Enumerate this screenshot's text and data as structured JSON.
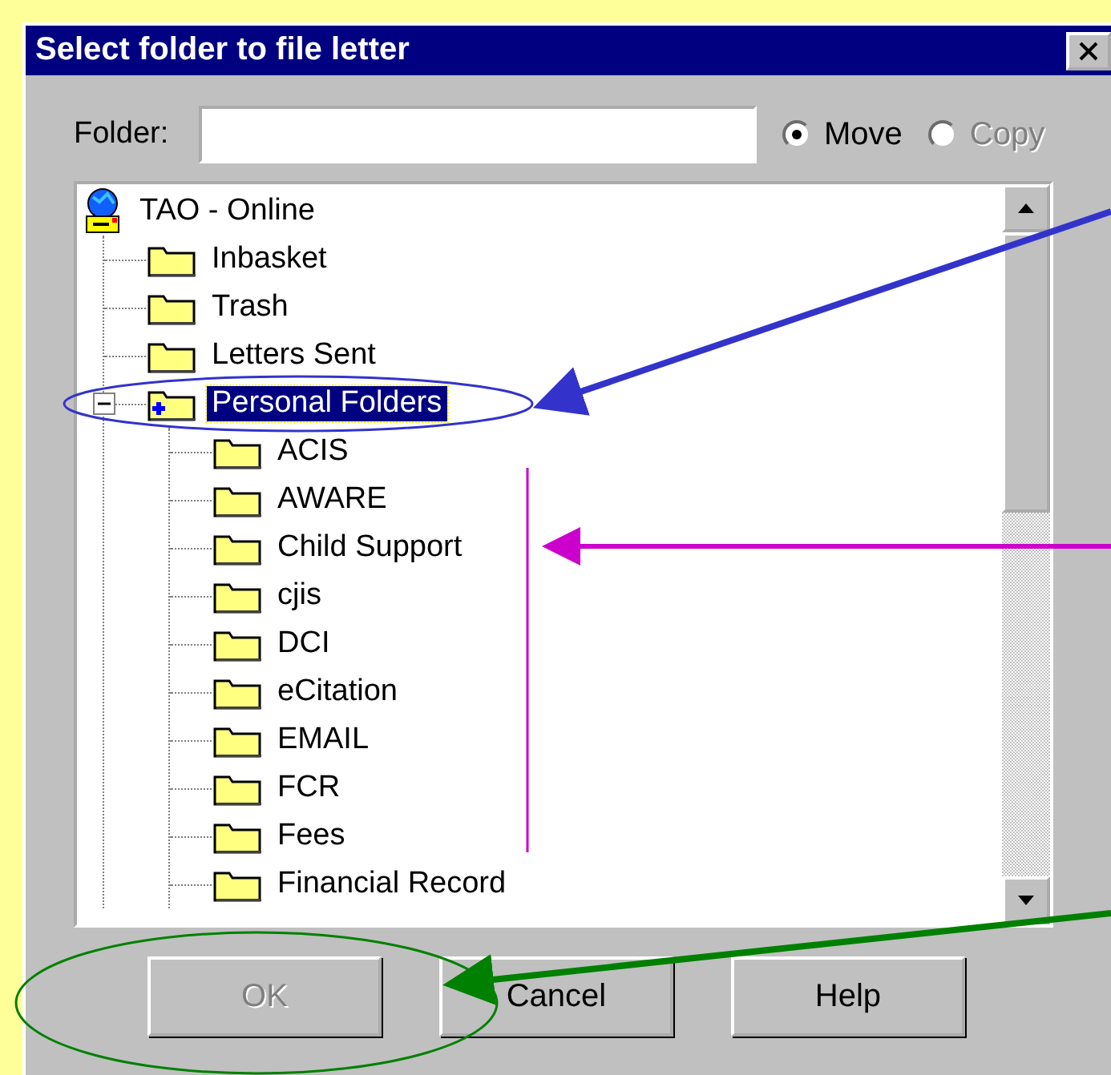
{
  "window": {
    "title": "Select folder to file letter"
  },
  "folder_field": {
    "label": "Folder:"
  },
  "mode_options": [
    {
      "label": "Move",
      "selected": true,
      "disabled": false
    },
    {
      "label": "Copy",
      "selected": false,
      "disabled": true
    }
  ],
  "tree": {
    "label": "TAO - Online",
    "kind": "root",
    "children": [
      {
        "label": "Inbasket",
        "kind": "folder",
        "selected": false
      },
      {
        "label": "Trash",
        "kind": "folder",
        "selected": false
      },
      {
        "label": "Letters Sent",
        "kind": "folder",
        "selected": false
      },
      {
        "label": "Personal Folders",
        "kind": "personal",
        "selected": true,
        "expanded": true,
        "children": [
          {
            "label": "ACIS",
            "kind": "folder",
            "selected": false
          },
          {
            "label": "AWARE",
            "kind": "folder",
            "selected": false
          },
          {
            "label": "Child Support",
            "kind": "folder",
            "selected": false
          },
          {
            "label": "cjis",
            "kind": "folder",
            "selected": false
          },
          {
            "label": "DCI",
            "kind": "folder",
            "selected": false
          },
          {
            "label": "eCitation",
            "kind": "folder",
            "selected": false
          },
          {
            "label": "EMAIL",
            "kind": "folder",
            "selected": false
          },
          {
            "label": "FCR",
            "kind": "folder",
            "selected": false
          },
          {
            "label": "Fees",
            "kind": "folder",
            "selected": false
          },
          {
            "label": "Financial Record",
            "kind": "folder",
            "selected": false
          }
        ]
      }
    ]
  },
  "buttons": [
    {
      "label": "OK",
      "disabled": true
    },
    {
      "label": "Cancel",
      "disabled": false
    },
    {
      "label": "Help",
      "disabled": false
    }
  ]
}
